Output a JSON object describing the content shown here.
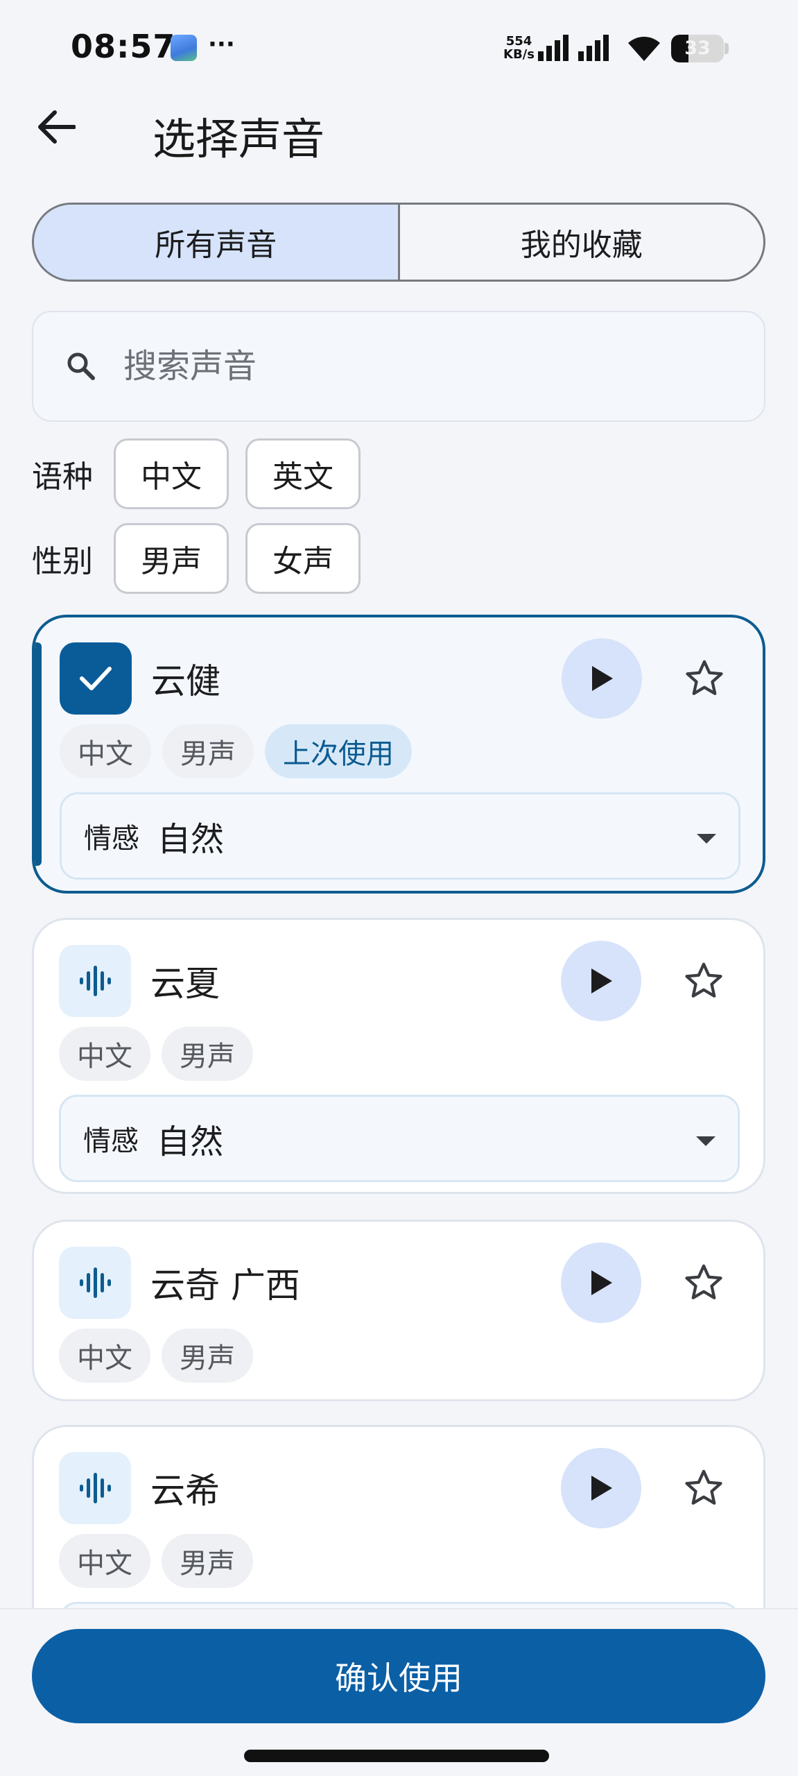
{
  "status_bar": {
    "time": "08:57",
    "more": "···",
    "net_speed_value": "554",
    "net_speed_unit": "KB/s",
    "battery": "33",
    "battery_level_pct": 33
  },
  "header": {
    "title": "选择声音",
    "back_icon": "arrow-left-icon"
  },
  "tabs": [
    {
      "label": "所有声音",
      "active": true
    },
    {
      "label": "我的收藏",
      "active": false
    }
  ],
  "search": {
    "placeholder": "搜索声音",
    "value": ""
  },
  "filters": [
    {
      "label": "语种",
      "options": [
        "中文",
        "英文"
      ]
    },
    {
      "label": "性别",
      "options": [
        "男声",
        "女声"
      ]
    }
  ],
  "voices": [
    {
      "name": "云健",
      "selected": true,
      "tags": [
        "中文",
        "男声",
        "上次使用"
      ],
      "emotion_label": "情感",
      "emotion_value": "自然"
    },
    {
      "name": "云夏",
      "selected": false,
      "tags": [
        "中文",
        "男声"
      ],
      "emotion_label": "情感",
      "emotion_value": "自然"
    },
    {
      "name": "云奇 广西",
      "selected": false,
      "tags": [
        "中文",
        "男声"
      ]
    },
    {
      "name": "云希",
      "selected": false,
      "tags": [
        "中文",
        "男声"
      ]
    }
  ],
  "confirm_label": "确认使用",
  "colors": {
    "accent": "#0b5fa5",
    "selected_border": "#0d5c8f",
    "segment_active": "#d6e3fa",
    "play_button": "#d6e3fa",
    "background": "#f3f5f9"
  }
}
